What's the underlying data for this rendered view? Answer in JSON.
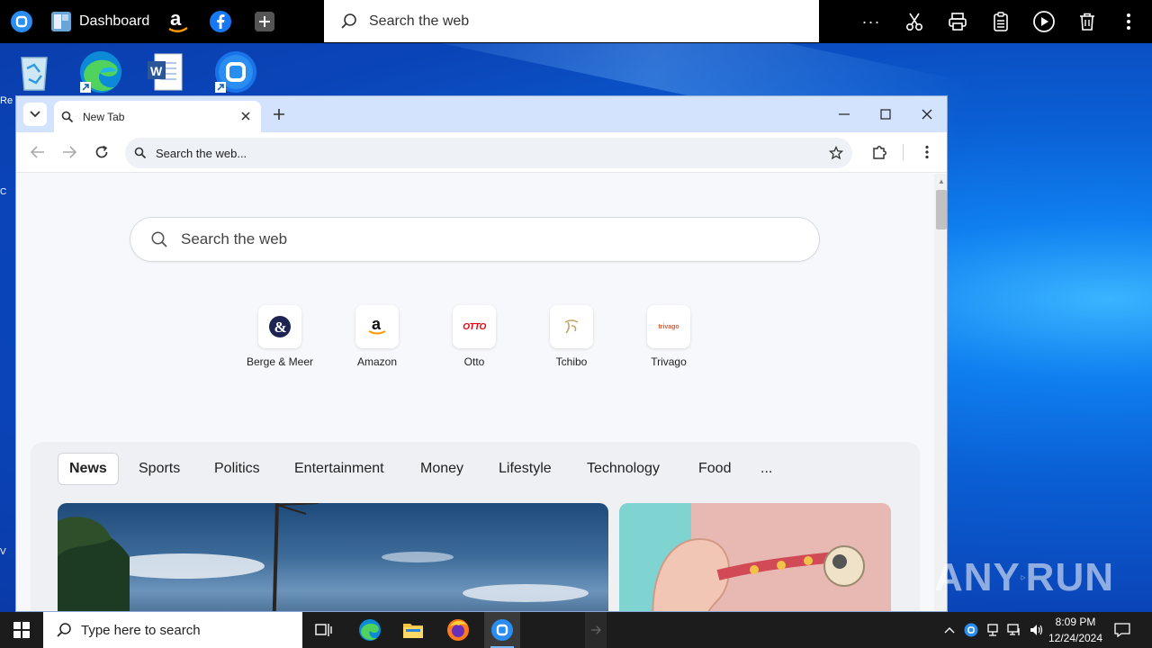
{
  "topbar": {
    "dashboard_label": "Dashboard",
    "search_placeholder": "Search the web",
    "more_label": "···"
  },
  "desktop": {
    "left_labels": [
      "Re",
      "C",
      "V"
    ]
  },
  "browser": {
    "tab_title": "New Tab",
    "address_placeholder": "Search the web...",
    "page_search_placeholder": "Search the web",
    "shortcuts": [
      {
        "label": "Berge & Meer",
        "icon": "berge-meer-icon"
      },
      {
        "label": "Amazon",
        "icon": "amazon-icon"
      },
      {
        "label": "Otto",
        "icon": "otto-icon"
      },
      {
        "label": "Tchibo",
        "icon": "tchibo-icon"
      },
      {
        "label": "Trivago",
        "icon": "trivago-icon"
      }
    ],
    "shortcut_text": {
      "amazon": "a",
      "otto": "OTTO",
      "trivago": "trivago"
    },
    "categories": [
      "News",
      "Sports",
      "Politics",
      "Entertainment",
      "Money",
      "Lifestyle",
      "Technology",
      "Food",
      "..."
    ]
  },
  "taskbar": {
    "search_placeholder": "Type here to search",
    "time": "8:09 PM",
    "date": "12/24/2024"
  },
  "watermark": {
    "left": "ANY",
    "right": "RUN"
  },
  "colors": {
    "accent": "#0a63d6",
    "tabstrip": "#d3e3fd",
    "otto_red": "#e3000f"
  }
}
